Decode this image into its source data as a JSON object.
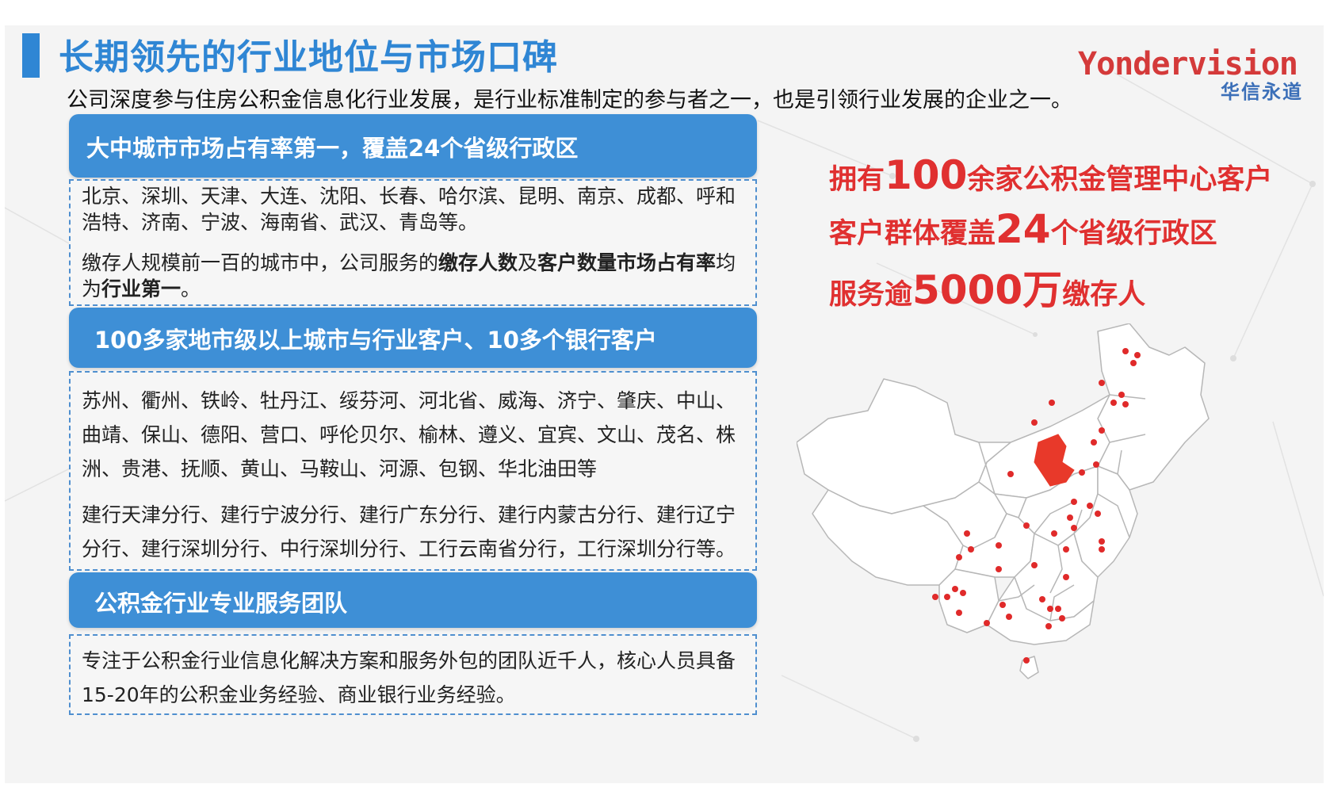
{
  "header": {
    "title": "长期领先的行业地位与市场口碑",
    "subtitle": "公司深度参与住房公积金信息化行业发展，是行业标准制定的参与者之一，也是引领行业发展的企业之一。",
    "logo_en": "Yondervision",
    "logo_cn": "华信永道"
  },
  "sections": [
    {
      "heading": "大中城市市场占有率第一，覆盖24个省级行政区",
      "cities": "北京、深圳、天津、大连、沈阳、长春、哈尔滨、昆明、南京、成都、呼和浩特、济南、宁波、海南省、武汉、青岛等。",
      "note_pre": "缴存人规模前一百的城市中，公司服务的",
      "note_b1": "缴存人数",
      "note_mid": "及",
      "note_b2": "客户数量市场占有率",
      "note_mid2": "均为",
      "note_b3": "行业第一",
      "note_end": "。"
    },
    {
      "heading": "100多家地市级以上城市与行业客户、10多个银行客户",
      "cities": "苏州、衢州、铁岭、牡丹江、绥芬河、河北省、威海、济宁、肇庆、中山、曲靖、保山、德阳、营口、呼伦贝尔、榆林、遵义、宜宾、文山、茂名、株洲、贵港、抚顺、黄山、马鞍山、河源、包钢、华北油田等",
      "banks": "建行天津分行、建行宁波分行、建行广东分行、建行内蒙古分行、建行辽宁分行、建行深圳分行、中行深圳分行、工行云南省分行，工行深圳分行等。"
    },
    {
      "heading": "公积金行业专业服务团队",
      "text": "专注于公积金行业信息化解决方案和服务外包的团队近千人，核心人员具备15-20年的公积金业务经验、商业银行业务经验。"
    }
  ],
  "stats": [
    {
      "pre": "拥有",
      "num": "100",
      "post": "余家公积金管理中心客户"
    },
    {
      "pre": "客户群体覆盖",
      "num": "24",
      "post": "个省级行政区"
    },
    {
      "pre": "服务逾",
      "num": "5000万",
      "post": "缴存人"
    }
  ],
  "colors": {
    "accent_blue": "#3e8fd6",
    "title_blue": "#2f86d4",
    "stat_red": "#e03030",
    "map_highlight": "#e8392a",
    "logo_red": "#d43a3a"
  },
  "icons": {
    "logo": "yondervision-logo",
    "map": "china-map"
  }
}
